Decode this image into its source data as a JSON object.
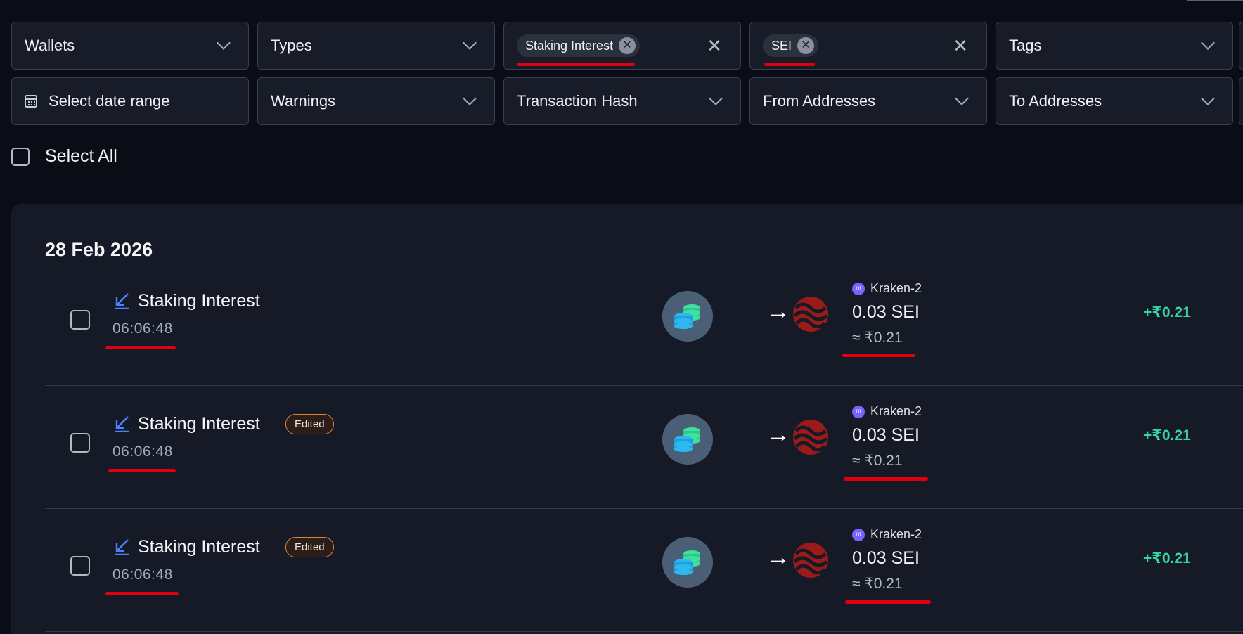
{
  "filters": {
    "row1": [
      {
        "label": "Wallets",
        "kind": "dropdown"
      },
      {
        "label": "Types",
        "kind": "dropdown"
      },
      {
        "kind": "chips",
        "chips": [
          "Staking Interest"
        ]
      },
      {
        "kind": "chips",
        "chips": [
          "SEI"
        ]
      },
      {
        "label": "Tags",
        "kind": "dropdown"
      }
    ],
    "row2": [
      {
        "label": "Select date range",
        "kind": "date"
      },
      {
        "label": "Warnings",
        "kind": "dropdown"
      },
      {
        "label": "Transaction Hash",
        "kind": "dropdown"
      },
      {
        "label": "From Addresses",
        "kind": "dropdown"
      },
      {
        "label": "To Addresses",
        "kind": "dropdown"
      }
    ]
  },
  "select_all": {
    "label": "Select All",
    "checked": false
  },
  "group": {
    "date": "28 Feb 2026",
    "transactions": [
      {
        "type": "Staking Interest",
        "edited": false,
        "time": "06:06:48",
        "from_icon": "coins-stack-icon",
        "to_icon": "sei-token-icon",
        "wallet": "Kraken-2",
        "amount": "0.03 SEI",
        "fiat": "≈ ₹0.21",
        "gain": "+₹0.21"
      },
      {
        "type": "Staking Interest",
        "edited": true,
        "edited_label": "Edited",
        "time": "06:06:48",
        "from_icon": "coins-stack-icon",
        "to_icon": "sei-token-icon",
        "wallet": "Kraken-2",
        "amount": "0.03 SEI",
        "fiat": "≈ ₹0.21",
        "gain": "+₹0.21"
      },
      {
        "type": "Staking Interest",
        "edited": true,
        "edited_label": "Edited",
        "time": "06:06:48",
        "from_icon": "coins-stack-icon",
        "to_icon": "sei-token-icon",
        "wallet": "Kraken-2",
        "amount": "0.03 SEI",
        "fiat": "≈ ₹0.21",
        "gain": "+₹0.21"
      }
    ]
  },
  "colors": {
    "background": "#0a0c16",
    "panel": "#161a26",
    "gain": "#35d6a4",
    "edited_border": "#d9833f",
    "annotation_red": "#e0000e",
    "kraken": "#7b61ff",
    "sei": "#9b1b1b"
  }
}
